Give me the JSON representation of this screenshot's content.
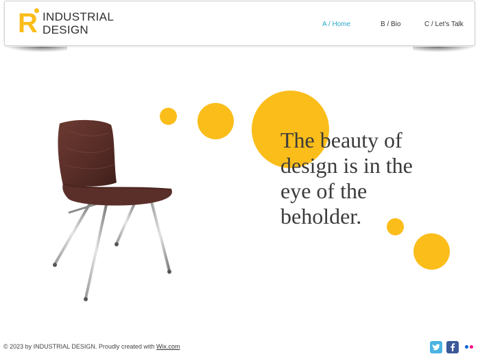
{
  "brand": {
    "mark": "R",
    "line1": "INDUSTRIAL",
    "line2": "DESIGN",
    "accent_color": "#fbbd1a"
  },
  "nav": {
    "items": [
      {
        "label": "A / Home",
        "active": true
      },
      {
        "label": "B / Bio",
        "active": false
      },
      {
        "label": "C / Let's Talk",
        "active": false
      }
    ],
    "active_color": "#2aa6c8"
  },
  "hero": {
    "quote_lines": [
      "The beauty of",
      "design is in the",
      "eye of the",
      "beholder."
    ],
    "image": "chair-photo"
  },
  "footer": {
    "text": "© 2023 by INDUSTRIAL DESIGN. Proudly created with ",
    "link": "Wix.com"
  },
  "social": [
    {
      "icon": "twitter-icon",
      "color": "#4ab3e2"
    },
    {
      "icon": "facebook-icon",
      "color": "#3b5998"
    },
    {
      "icon": "flickr-icon",
      "colors": [
        "#0063dc",
        "#ff0084"
      ]
    }
  ]
}
